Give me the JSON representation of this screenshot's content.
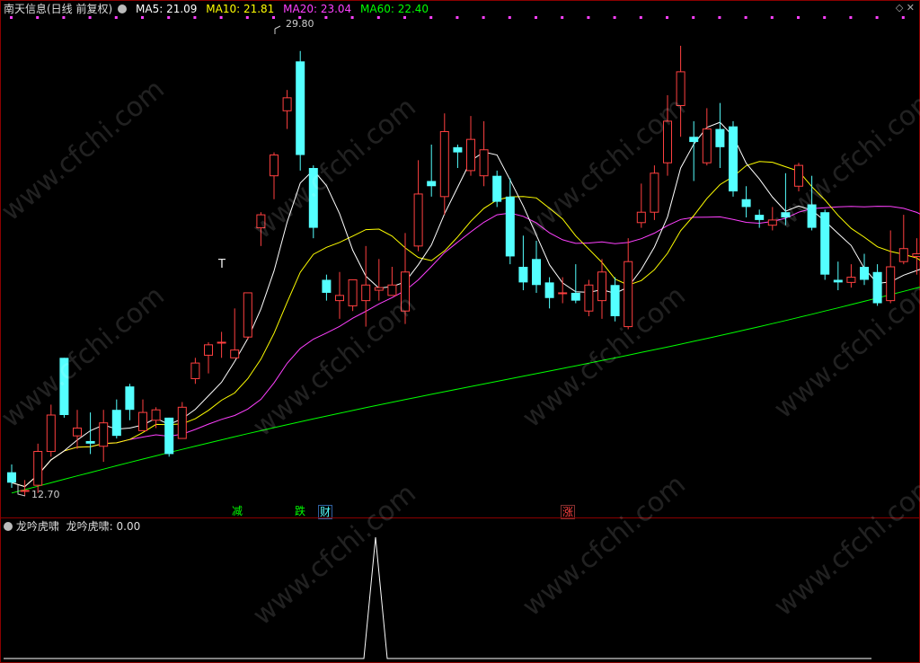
{
  "header": {
    "stock": "南天信息(日线 前复权)",
    "ma5": "MA5: 21.09",
    "ma10": "MA10: 21.81",
    "ma20": "MA20: 23.04",
    "ma60": "MA60: 22.40"
  },
  "colors": {
    "up": "#ff4040",
    "down": "#54ffff",
    "ma5": "#ffffff",
    "ma10": "#ffff00",
    "ma20": "#ff40ff",
    "ma60": "#00ff00"
  },
  "annotations": {
    "high": "29.80",
    "low": "12.70",
    "t_marker": "T"
  },
  "signals": [
    {
      "text": "减",
      "color": "#00ff00"
    },
    {
      "text": "跌",
      "color": "#00ff00"
    },
    {
      "text": "财",
      "color": "#54ffff"
    },
    {
      "text": "涨",
      "color": "#ff4040"
    }
  ],
  "sub": {
    "name": "龙吟虎啸",
    "value": "龙吟虎啸: 0.00"
  },
  "watermark": "www.cfchi.com",
  "chart_data": {
    "type": "candlestick",
    "price_range": [
      12.0,
      31.0
    ],
    "candles": [
      [
        13.6,
        13.2,
        13.9,
        13.0
      ],
      [
        12.9,
        12.9,
        13.3,
        12.7
      ],
      [
        13.1,
        14.4,
        14.7,
        12.8
      ],
      [
        14.4,
        15.8,
        16.2,
        14.2
      ],
      [
        18.0,
        15.8,
        18.0,
        15.7
      ],
      [
        15.0,
        15.3,
        16.0,
        14.5
      ],
      [
        14.8,
        14.7,
        15.9,
        14.3
      ],
      [
        14.6,
        15.5,
        16.0,
        14.0
      ],
      [
        16.0,
        15.0,
        16.4,
        14.9
      ],
      [
        16.9,
        16.0,
        17.0,
        15.6
      ],
      [
        15.2,
        15.9,
        16.4,
        15.2
      ],
      [
        15.6,
        16.0,
        16.1,
        15.3
      ],
      [
        15.7,
        14.3,
        15.7,
        14.2
      ],
      [
        14.9,
        16.1,
        16.3,
        14.9
      ],
      [
        17.2,
        17.8,
        18.0,
        17.0
      ],
      [
        18.1,
        18.5,
        18.6,
        17.4
      ],
      [
        18.6,
        18.6,
        19.0,
        18.0
      ],
      [
        18.0,
        18.3,
        19.9,
        18.0
      ],
      [
        18.8,
        20.5,
        20.5,
        18.7
      ],
      [
        23.0,
        23.5,
        23.6,
        22.3
      ],
      [
        25.0,
        25.8,
        25.9,
        24.1
      ],
      [
        27.5,
        28.0,
        28.3,
        26.8
      ],
      [
        29.4,
        25.8,
        29.8,
        25.2
      ],
      [
        25.3,
        23.0,
        25.4,
        22.6
      ],
      [
        21.0,
        20.5,
        21.2,
        20.2
      ],
      [
        20.2,
        20.4,
        21.3,
        19.5
      ],
      [
        20.0,
        21.0,
        21.0,
        19.8
      ],
      [
        20.2,
        20.8,
        22.3,
        19.2
      ],
      [
        20.6,
        20.7,
        21.8,
        20.2
      ],
      [
        20.4,
        20.8,
        21.5,
        20.5
      ],
      [
        19.8,
        21.3,
        22.8,
        19.3
      ],
      [
        22.3,
        24.3,
        25.6,
        22.1
      ],
      [
        24.8,
        24.6,
        26.2,
        24.2
      ],
      [
        24.2,
        26.7,
        27.4,
        23.5
      ],
      [
        26.1,
        25.9,
        26.2,
        25.3
      ],
      [
        25.2,
        26.4,
        27.3,
        25.0
      ],
      [
        25.0,
        26.0,
        27.1,
        24.6
      ],
      [
        25.0,
        24.0,
        25.2,
        23.8
      ],
      [
        24.2,
        21.9,
        24.9,
        21.6
      ],
      [
        21.5,
        20.9,
        22.7,
        20.6
      ],
      [
        21.8,
        20.8,
        22.5,
        20.5
      ],
      [
        20.9,
        20.3,
        21.1,
        19.9
      ],
      [
        20.5,
        20.5,
        21.1,
        20.1
      ],
      [
        20.5,
        20.2,
        21.6,
        20.1
      ],
      [
        19.8,
        20.8,
        21.0,
        19.6
      ],
      [
        20.2,
        21.3,
        21.8,
        19.5
      ],
      [
        20.8,
        19.6,
        21.1,
        19.4
      ],
      [
        19.2,
        21.7,
        22.6,
        19.1
      ],
      [
        23.2,
        23.6,
        24.7,
        23.0
      ],
      [
        23.6,
        25.1,
        25.4,
        23.3
      ],
      [
        25.5,
        27.1,
        28.1,
        25.0
      ],
      [
        27.7,
        29.0,
        30.0,
        26.5
      ],
      [
        26.5,
        26.3,
        27.1,
        24.8
      ],
      [
        25.5,
        26.8,
        27.6,
        25.4
      ],
      [
        26.8,
        26.1,
        27.8,
        25.3
      ],
      [
        26.9,
        24.4,
        27.1,
        24.2
      ],
      [
        24.1,
        23.8,
        24.6,
        23.4
      ],
      [
        23.5,
        23.3,
        23.7,
        23.0
      ],
      [
        23.1,
        23.3,
        23.8,
        22.9
      ],
      [
        23.6,
        23.4,
        25.1,
        23.1
      ],
      [
        24.6,
        25.4,
        25.5,
        24.4
      ],
      [
        23.9,
        23.0,
        25.0,
        22.9
      ],
      [
        23.6,
        21.2,
        23.7,
        21.0
      ],
      [
        21.0,
        20.9,
        21.7,
        20.6
      ],
      [
        20.9,
        21.1,
        21.6,
        20.7
      ],
      [
        21.5,
        21.0,
        22.0,
        20.8
      ],
      [
        21.3,
        20.1,
        21.6,
        20.0
      ],
      [
        20.2,
        21.5,
        22.9,
        20.1
      ],
      [
        21.7,
        22.2,
        23.5,
        21.6
      ],
      [
        21.9,
        22.0,
        22.6,
        21.2
      ],
      [
        21.5,
        21.9,
        22.5,
        21.1
      ],
      [
        21.5,
        21.6,
        22.2,
        20.6
      ],
      [
        21.4,
        21.1,
        21.6,
        20.1
      ],
      [
        21.3,
        19.8,
        21.7,
        19.7
      ],
      [
        19.5,
        19.4,
        19.8,
        18.8
      ],
      [
        19.4,
        18.8,
        19.6,
        18.6
      ],
      [
        18.8,
        19.1,
        19.7,
        18.4
      ]
    ],
    "ma_series_names": [
      "MA5",
      "MA10",
      "MA20",
      "MA60"
    ]
  }
}
